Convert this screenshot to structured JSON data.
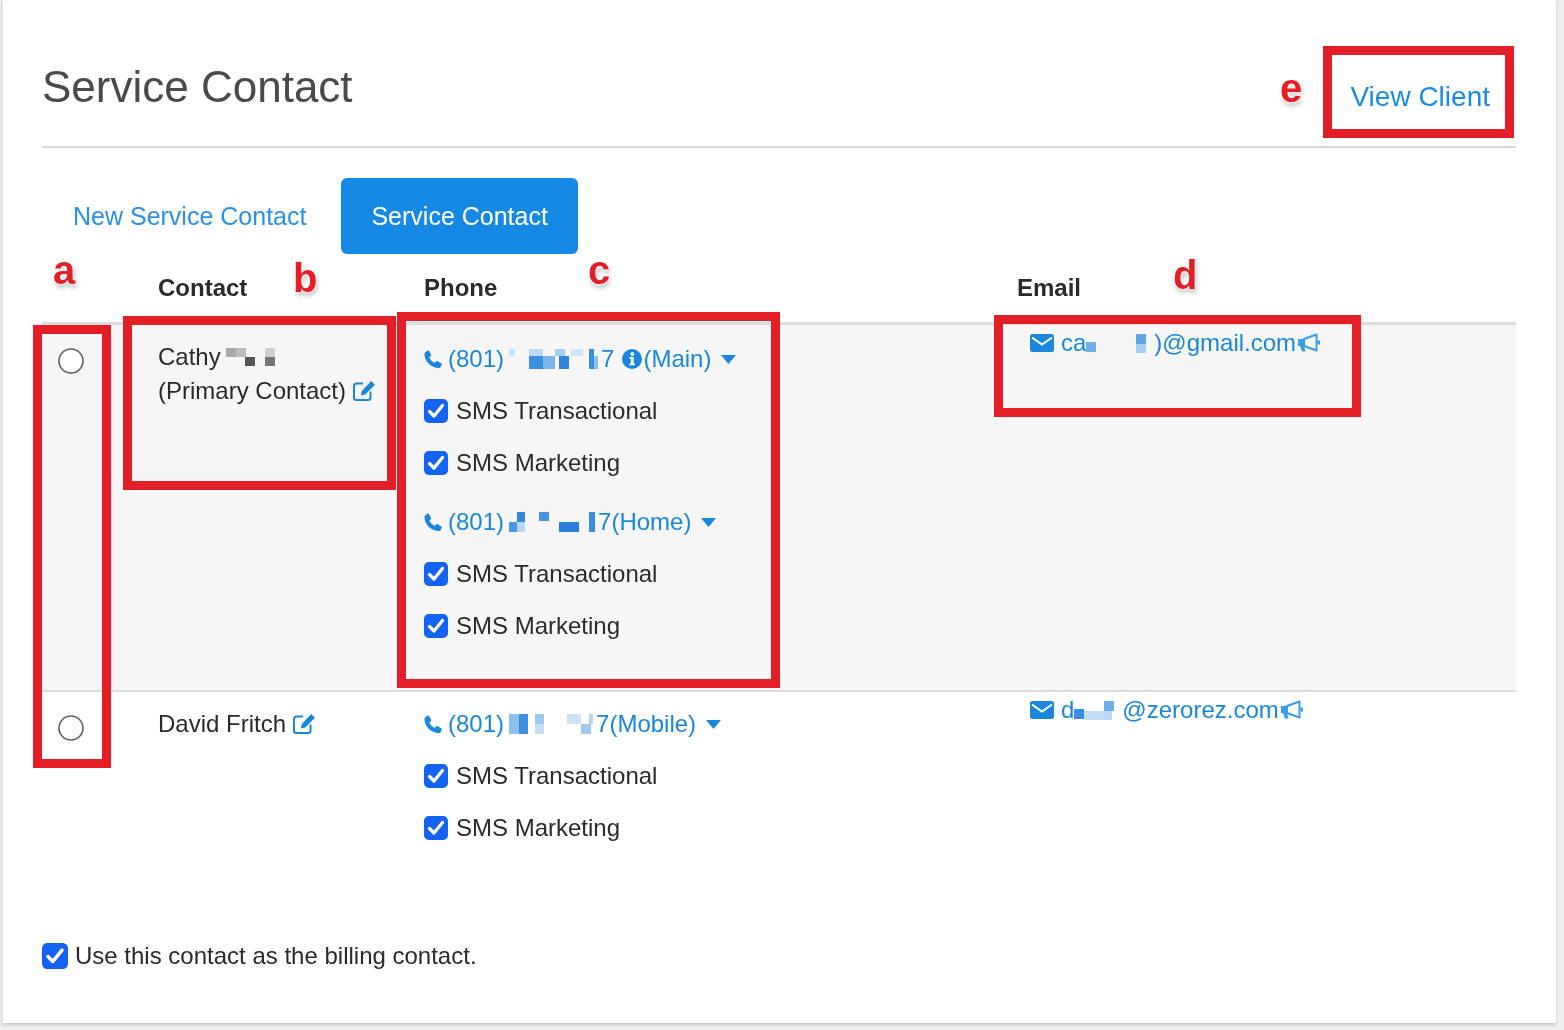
{
  "page": {
    "title": "Service Contact",
    "view_client_link": "View Client"
  },
  "tabs": [
    {
      "label": "New Service Contact",
      "selected": false
    },
    {
      "label": "Service Contact",
      "selected": true
    }
  ],
  "table": {
    "columns": [
      "Contact",
      "Phone",
      "Email"
    ],
    "rows": [
      {
        "selected": false,
        "highlighted": true,
        "contact": {
          "name": "Cathy",
          "name_redacted": true,
          "note": "(Primary Contact)"
        },
        "phones": [
          {
            "number_start": "(801)",
            "number_end": "7",
            "info": true,
            "type": "(Main)",
            "options": [
              {
                "label": "SMS Transactional",
                "checked": true
              },
              {
                "label": "SMS Marketing",
                "checked": true
              }
            ]
          },
          {
            "number_start": "(801)",
            "number_end": "7",
            "info": false,
            "type": "(Home)",
            "options": [
              {
                "label": "SMS Transactional",
                "checked": true
              },
              {
                "label": "SMS Marketing",
                "checked": true
              }
            ]
          }
        ],
        "email": {
          "start": "ca",
          "end": ")@gmail.com"
        }
      },
      {
        "selected": false,
        "highlighted": false,
        "contact": {
          "name": "David Fritch",
          "name_redacted": false
        },
        "phones": [
          {
            "number_start": "(801)",
            "number_end": "7",
            "info": false,
            "type": "(Mobile)",
            "options": [
              {
                "label": "SMS Transactional",
                "checked": true
              },
              {
                "label": "SMS Marketing",
                "checked": true
              }
            ]
          }
        ],
        "email": {
          "start": "d",
          "end": "@zerorez.com"
        }
      }
    ]
  },
  "billing": {
    "label": "Use this contact as the billing contact.",
    "checked": true
  },
  "annotations": [
    {
      "label": "a"
    },
    {
      "label": "b"
    },
    {
      "label": "c"
    },
    {
      "label": "d"
    },
    {
      "label": "e"
    }
  ]
}
